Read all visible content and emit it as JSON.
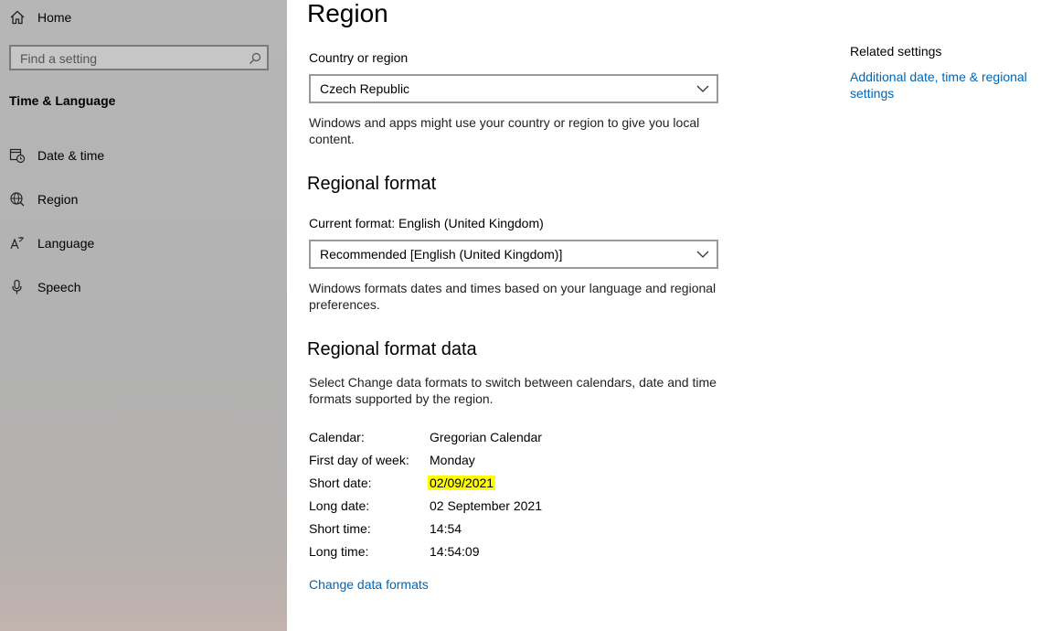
{
  "sidebar": {
    "home_label": "Home",
    "search_placeholder": "Find a setting",
    "section_title": "Time & Language",
    "items": [
      {
        "label": "Date & time",
        "icon": "calendar-clock-icon"
      },
      {
        "label": "Region",
        "icon": "globe-icon"
      },
      {
        "label": "Language",
        "icon": "language-icon"
      },
      {
        "label": "Speech",
        "icon": "microphone-icon"
      }
    ]
  },
  "main": {
    "title": "Region",
    "country": {
      "label": "Country or region",
      "value": "Czech Republic",
      "description": "Windows and apps might use your country or region to give you local content."
    },
    "regional_format": {
      "heading": "Regional format",
      "current_label": "Current format: English (United Kingdom)",
      "value": "Recommended [English (United Kingdom)]",
      "description": "Windows formats dates and times based on your language and regional preferences."
    },
    "format_data": {
      "heading": "Regional format data",
      "description": "Select Change data formats to switch between calendars, date and time formats supported by the region.",
      "rows": [
        {
          "key": "Calendar:",
          "value": "Gregorian Calendar"
        },
        {
          "key": "First day of week:",
          "value": "Monday"
        },
        {
          "key": "Short date:",
          "value": "02/09/2021"
        },
        {
          "key": "Long date:",
          "value": "02 September 2021"
        },
        {
          "key": "Short time:",
          "value": "14:54"
        },
        {
          "key": "Long time:",
          "value": "14:54:09"
        }
      ],
      "change_link": "Change data formats"
    }
  },
  "related": {
    "title": "Related settings",
    "link": "Additional date, time & regional settings"
  },
  "colors": {
    "link": "#0066b4",
    "highlight": "#ffff00"
  }
}
